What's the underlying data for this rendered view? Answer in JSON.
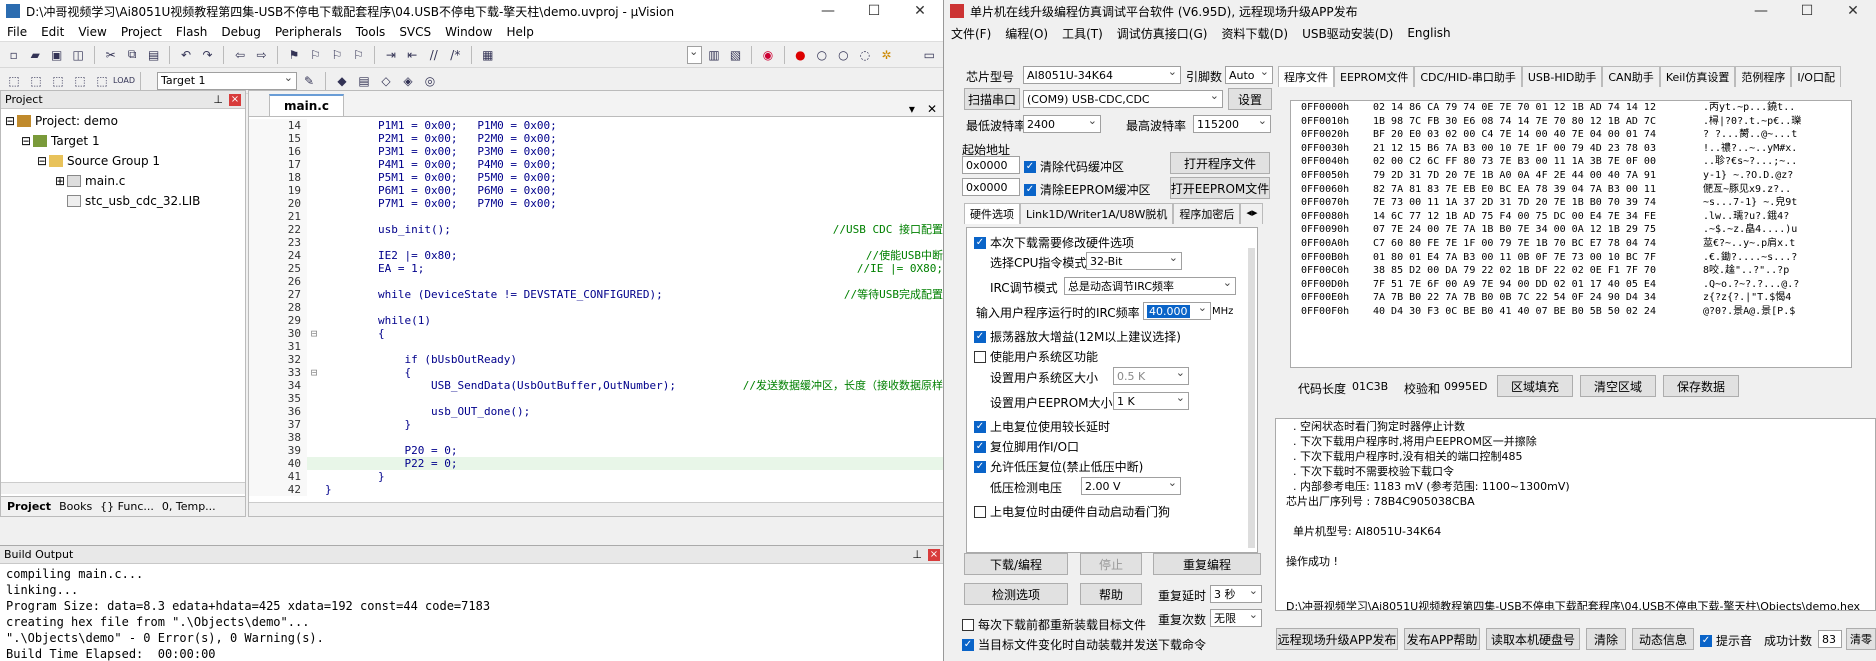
{
  "uvision": {
    "title": "D:\\冲哥视频学习\\Ai8051U视频教程第四集-USB不停电下载配套程序\\04.USB不停电下载-擎天柱\\demo.uvproj - µVision",
    "menu": [
      "File",
      "Edit",
      "View",
      "Project",
      "Flash",
      "Debug",
      "Peripherals",
      "Tools",
      "SVCS",
      "Window",
      "Help"
    ],
    "target_label": "Target 1",
    "project_panel": {
      "header": "Project",
      "root": "Project: demo",
      "target": "Target 1",
      "group": "Source Group 1",
      "file1": "main.c",
      "file2": "stc_usb_cdc_32.LIB",
      "tabs": [
        "Project",
        "Books",
        "{} Func...",
        "0, Temp..."
      ]
    },
    "editor_tab": "main.c",
    "code_lines": [
      {
        "n": "14",
        "t": "        P1M1 = 0x00;   P1M0 = 0x00;",
        "c": ""
      },
      {
        "n": "15",
        "t": "        P2M1 = 0x00;   P2M0 = 0x00;",
        "c": ""
      },
      {
        "n": "16",
        "t": "        P3M1 = 0x00;   P3M0 = 0x00;",
        "c": ""
      },
      {
        "n": "17",
        "t": "        P4M1 = 0x00;   P4M0 = 0x00;",
        "c": ""
      },
      {
        "n": "18",
        "t": "        P5M1 = 0x00;   P5M0 = 0x00;",
        "c": ""
      },
      {
        "n": "19",
        "t": "        P6M1 = 0x00;   P6M0 = 0x00;",
        "c": ""
      },
      {
        "n": "20",
        "t": "        P7M1 = 0x00;   P7M0 = 0x00;",
        "c": ""
      },
      {
        "n": "21",
        "t": "",
        "c": ""
      },
      {
        "n": "22",
        "t": "        usb_init();                                       ",
        "c": "//USB CDC 接口配置"
      },
      {
        "n": "23",
        "t": "",
        "c": ""
      },
      {
        "n": "24",
        "t": "        IE2 |= 0x80;                                      ",
        "c": "//使能USB中断"
      },
      {
        "n": "25",
        "t": "        EA = 1;                                           ",
        "c": "//IE |= 0X80;"
      },
      {
        "n": "26",
        "t": "",
        "c": ""
      },
      {
        "n": "27",
        "t": "        while (DeviceState != DEVSTATE_CONFIGURED);       ",
        "c": "//等待USB完成配置"
      },
      {
        "n": "28",
        "t": "",
        "c": ""
      },
      {
        "n": "29",
        "t": "        while(1)",
        "c": ""
      },
      {
        "n": "30",
        "t": "        {",
        "c": ""
      },
      {
        "n": "31",
        "t": "",
        "c": ""
      },
      {
        "n": "32",
        "t": "            if (bUsbOutReady)",
        "c": ""
      },
      {
        "n": "33",
        "t": "            {",
        "c": ""
      },
      {
        "n": "34",
        "t": "                USB_SendData(UsbOutBuffer,OutNumber);     ",
        "c": "//发送数据缓冲区，长度（接收数据原样"
      },
      {
        "n": "35",
        "t": "",
        "c": ""
      },
      {
        "n": "36",
        "t": "                usb_OUT_done();",
        "c": ""
      },
      {
        "n": "37",
        "t": "            }",
        "c": ""
      },
      {
        "n": "38",
        "t": "",
        "c": ""
      },
      {
        "n": "39",
        "t": "            P20 = 0;",
        "c": ""
      },
      {
        "n": "40",
        "t": "            P22 = 0;",
        "c": ""
      },
      {
        "n": "41",
        "t": "        }",
        "c": ""
      },
      {
        "n": "42",
        "t": "}",
        "c": ""
      }
    ],
    "build_output": {
      "header": "Build Output",
      "lines": [
        "compiling main.c...",
        "linking...",
        "Program Size: data=8.3 edata+hdata=425 xdata=192 const=44 code=7183",
        "creating hex file from \".\\Objects\\demo\"...",
        "\".\\Objects\\demo\" - 0 Error(s), 0 Warning(s).",
        "Build Time Elapsed:  00:00:00"
      ]
    }
  },
  "isp": {
    "title": "单片机在线升级编程仿真调试平台软件 (V6.95D), 远程现场升级APP发布",
    "menu": [
      "文件(F)",
      "编程(O)",
      "工具(T)",
      "调试仿真接口(G)",
      "资料下载(D)",
      "USB驱动安装(D)",
      "English"
    ],
    "chip_label": "芯片型号",
    "chip_value": "AI8051U-34K64",
    "pin_label": "引脚数",
    "pin_value": "Auto",
    "scan_btn": "扫描串口",
    "port_value": "(COM9) USB-CDC,CDC",
    "settings_btn": "设置",
    "min_baud_label": "最低波特率",
    "min_baud": "2400",
    "max_baud_label": "最高波特率",
    "max_baud": "115200",
    "start_addr_label": "起始地址",
    "addr1": "0x0000",
    "clear_code": "清除代码缓冲区",
    "open_prog_btn": "打开程序文件",
    "addr2": "0x0000",
    "clear_eeprom": "清除EEPROM缓冲区",
    "open_eeprom_btn": "打开EEPROM文件",
    "left_tabs": [
      "硬件选项",
      "Link1D/Writer1A/U8W脱机",
      "程序加密后"
    ],
    "hw_options": {
      "opt1": "本次下载需要修改硬件选项",
      "cpu_mode_label": "选择CPU指令模式",
      "cpu_mode": "32-Bit",
      "irc_label": "IRC调节模式",
      "irc_mode": "总是动态调节IRC频率",
      "freq_label": "输入用户程序运行时的IRC频率",
      "freq_value": "40.000",
      "freq_unit": "MHz",
      "opt2": "振荡器放大增益(12M以上建议选择)",
      "opt3": "使能用户系统区功能",
      "sys_size_label": "设置用户系统区大小",
      "sys_size": "0.5 K",
      "eeprom_size_label": "设置用户EEPROM大小",
      "eeprom_size": "1   K",
      "opt4": "上电复位使用较长延时",
      "opt5": "复位脚用作I/O口",
      "opt6": "允许低压复位(禁止低压中断)",
      "lvd_label": "低压检测电压",
      "lvd_value": "2.00 V",
      "opt7": "上电复位时由硬件自动启动看门狗"
    },
    "btn_download": "下载/编程",
    "btn_stop": "停止",
    "btn_reprog": "重复编程",
    "btn_detect": "检测选项",
    "btn_help": "帮助",
    "delay_label": "重复延时",
    "delay_value": "3 秒",
    "repeat_label": "重复次数",
    "repeat_value": "无限",
    "opt_reload": "每次下载前都重新装载目标文件",
    "opt_autoload": "当目标文件变化时自动装载并发送下载命令",
    "right_tabs": [
      "程序文件",
      "EEPROM文件",
      "CDC/HID-串口助手",
      "USB-HID助手",
      "CAN助手",
      "Keil仿真设置",
      "范例程序",
      "I/O口配"
    ],
    "hex_rows": [
      [
        "0FF0000h",
        "02 14 86 CA 79 74 0E 7E 70 01 12 1B AD 74 14 12",
        ".丙yt.~p...鐃t.."
      ],
      [
        "0FF0010h",
        "1B 98 7C FB 30 E6 08 74 14 7E 70 80 12 1B AD 7C",
        ".樳|?0?.t.~p€..瓅"
      ],
      [
        "0FF0020h",
        "BF 20 E0 03 02 00 C4 7E 14 00 40 7E 04 00 01 74",
        "? ?...膥..@~...t"
      ],
      [
        "0FF0030h",
        "21 12 15 B6 7A B3 00 10 7E 1F 00 79 4D 23 78 03",
        "!..禯?..~..yM#x."
      ],
      [
        "0FF0040h",
        "02 00 C2 6C FF 80 73 7E B3 00 11 1A 3B 7E 0F 00",
        "..聄?€s~?...;~.."
      ],
      [
        "0FF0050h",
        "79 2D 31 7D 20 7E 1B A0 0A 4F 2E 44 00 40 7A 91",
        "y-1} ~.?O.D.@z?"
      ],
      [
        "0FF0060h",
        "82 7A 81 83 7E EB E0 BC EA 78 39 04 7A B3 00 11",
        "俷亙~豚见x9.z?.."
      ],
      [
        "0FF0070h",
        "7E 73 00 11 1A 37 2D 31 7D 20 7E 1B B0 70 39 74",
        "~s...7-1} ~.皃9t"
      ],
      [
        "0FF0080h",
        "14 6C 77 12 1B AD 75 F4 00 75 DC 00 E4 7E 34 FE",
        ".lw..瓀?u?.鋨4?"
      ],
      [
        "0FF0090h",
        "07 7E 24 00 7E 7A 1B B0 7E 34 00 0A 12 1B 29 75",
        ".~$.~z.皛4....)u"
      ],
      [
        "0FF00A0h",
        "C7 60 80 FE 7E 1F 00 79 7E 1B 70 BC E7 78 04 74",
        "莁€?~..y~.p肩x.t"
      ],
      [
        "0FF00B0h",
        "01 80 01 E4 7A B3 00 11 0B 0F 7E 73 00 10 BC 7F",
        ".€.鋤?....~s...?"
      ],
      [
        "0FF00C0h",
        "38 85 D2 00 DA 79 22 02 1B DF 22 02 0E F1 7F 70",
        "8咬.趛\"..?\"..?p"
      ],
      [
        "0FF00D0h",
        "7F 51 7E 6F 00 A9 7E 94 00 DD 02 01 17 40 05 E4",
        ".Q~o.?~?.?...@.?"
      ],
      [
        "0FF00E0h",
        "7A 7B B0 22 7A 7B B0 0B 7C 22 54 0F 24 90 D4 34",
        "z{?z{?.|\"T.$愒4"
      ],
      [
        "0FF00F0h",
        "40 D4 30 F3 0C BE B0 41 40 07 BE B0 5B 50 02 24",
        "@?0?.景A@.景[P.$"
      ]
    ],
    "code_len_label": "代码长度",
    "code_len": "01C3B",
    "checksum_label": "校验和",
    "checksum": "0995ED",
    "btn_fill": "区域填充",
    "btn_clear": "清空区域",
    "btn_save": "保存数据",
    "log": [
      "  . 空闲状态时看门狗定时器停止计数",
      "  . 下次下载用户程序时,将用户EEPROM区一并擦除",
      "  . 下次下载用户程序时,没有相关的端口控制485",
      "  . 下次下载时不需要校验下载口令",
      "  . 内部参考电压: 1183 mV (参考范围: 1100~1300mV)",
      "芯片出厂序列号 : 78B4C905038CBA",
      "",
      "  单片机型号: AI8051U-34K64",
      "",
      "操作成功 !",
      "",
      "",
      "D:\\冲哥视频学习\\Ai8051U视频教程第四集-USB不停电下载配套程序\\04.USB不停电下载-擎天柱\\Objects\\demo.hex"
    ],
    "bottom": {
      "b1": "远程现场升级APP发布",
      "b2": "发布APP帮助",
      "b3": "读取本机硬盘号",
      "b4": "清除",
      "b5": "动态信息",
      "chk": "提示音",
      "count_label": "成功计数",
      "count": "83",
      "b6": "清零"
    }
  }
}
